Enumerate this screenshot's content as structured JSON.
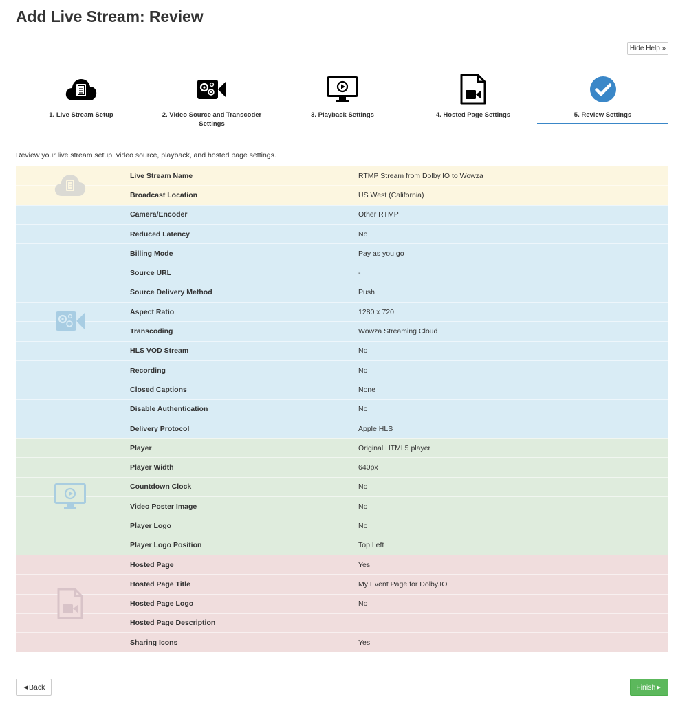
{
  "page": {
    "title": "Add Live Stream: Review"
  },
  "help": {
    "button_label": "Hide Help »"
  },
  "steps": [
    {
      "label": "1. Live Stream Setup",
      "icon": "cloud-document-icon"
    },
    {
      "label": "2. Video Source and Transcoder Settings",
      "icon": "gear-camera-icon"
    },
    {
      "label": "3. Playback Settings",
      "icon": "monitor-play-icon"
    },
    {
      "label": "4. Hosted Page Settings",
      "icon": "document-video-icon"
    },
    {
      "label": "5. Review Settings",
      "icon": "check-circle-icon",
      "active": true
    }
  ],
  "intro": "Review your live stream setup, video source, playback, and hosted page settings.",
  "review": {
    "setup": [
      {
        "label": "Live Stream Name",
        "value": "RTMP Stream from Dolby.IO to Wowza"
      },
      {
        "label": "Broadcast Location",
        "value": "US West (California)"
      }
    ],
    "video": [
      {
        "label": "Camera/Encoder",
        "value": "Other RTMP"
      },
      {
        "label": "Reduced Latency",
        "value": "No"
      },
      {
        "label": "Billing Mode",
        "value": "Pay as you go"
      },
      {
        "label": "Source URL",
        "value": "-"
      },
      {
        "label": "Source Delivery Method",
        "value": "Push"
      },
      {
        "label": "Aspect Ratio",
        "value": "1280 x 720"
      },
      {
        "label": "Transcoding",
        "value": "Wowza Streaming Cloud"
      },
      {
        "label": "HLS VOD Stream",
        "value": "No"
      },
      {
        "label": "Recording",
        "value": "No"
      },
      {
        "label": "Closed Captions",
        "value": "None"
      },
      {
        "label": "Disable Authentication",
        "value": "No"
      },
      {
        "label": "Delivery Protocol",
        "value": "Apple HLS"
      }
    ],
    "playback": [
      {
        "label": "Player",
        "value": "Original HTML5 player"
      },
      {
        "label": "Player Width",
        "value": "640px"
      },
      {
        "label": "Countdown Clock",
        "value": "No"
      },
      {
        "label": "Video Poster Image",
        "value": "No"
      },
      {
        "label": "Player Logo",
        "value": "No"
      },
      {
        "label": "Player Logo Position",
        "value": "Top Left"
      }
    ],
    "hosted": [
      {
        "label": "Hosted Page",
        "value": "Yes"
      },
      {
        "label": "Hosted Page Title",
        "value": "My Event Page for Dolby.IO"
      },
      {
        "label": "Hosted Page Logo",
        "value": "No"
      },
      {
        "label": "Hosted Page Description",
        "value": ""
      },
      {
        "label": "Sharing Icons",
        "value": "Yes"
      }
    ]
  },
  "footer": {
    "back_label": "Back",
    "finish_label": "Finish"
  },
  "colors": {
    "accent": "#3a87c8",
    "finish": "#5cb85c",
    "setup_bg": "#fcf6e0",
    "video_bg": "#d9ecf5",
    "playback_bg": "#dfecdd",
    "hosted_bg": "#f0dddd"
  }
}
